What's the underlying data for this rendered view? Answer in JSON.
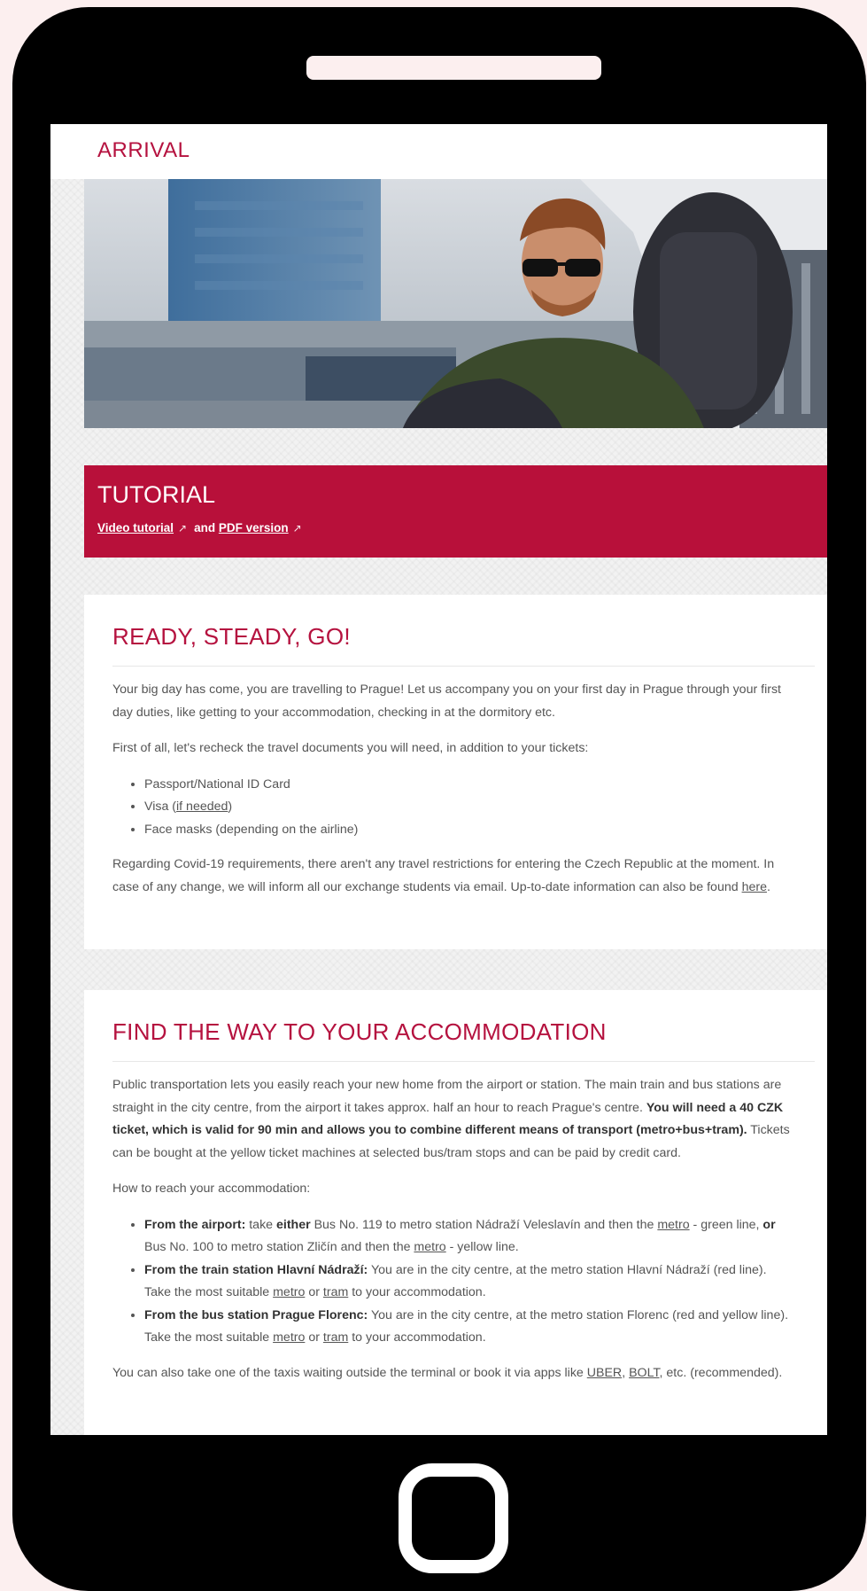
{
  "arrival": {
    "title": "ARRIVAL"
  },
  "tutorial": {
    "title": "TUTORIAL",
    "video_link": "Video tutorial",
    "and": "and",
    "pdf_link": "PDF version"
  },
  "ready": {
    "heading": "READY, STEADY, GO!",
    "p1": "Your big day has come, you are travelling to Prague! Let us accompany you on your first day in Prague through your first day duties, like getting to your accommodation, checking in at the dormitory etc.",
    "p2": "First of all, let's recheck the travel documents you will need, in addition to your tickets:",
    "doc1": "Passport/National ID Card",
    "doc2_pre": "Visa (",
    "doc2_link": "if needed",
    "doc2_post": ")",
    "doc3": "Face masks (depending on the airline)",
    "p3": "Regarding Covid-19 requirements, there aren't any travel restrictions for entering the Czech Republic at the moment. In case of any change, we will inform all our exchange students via email. Up-to-date information can also be found ",
    "p3_link": "here",
    "p3_end": "."
  },
  "accommodation": {
    "heading": "FIND THE WAY TO YOUR ACCOMMODATION",
    "p1_a": "Public transportation lets you easily reach your new home from the airport or station. The main train and bus stations are straight in the city centre, from the airport it takes approx. half an hour to reach Prague's centre. ",
    "p1_b": "You will need a 40 CZK ticket, which is valid for 90 min and allows you to combine different means of transport (metro+bus+tram).",
    "p1_c": " Tickets can be bought at the yellow ticket machines at selected bus/tram stops and can be paid by credit card.",
    "p2": "How to reach your accommodation:",
    "b1_label": "From the airport:",
    "b1_a": " take ",
    "b1_either": "either",
    "b1_b": " Bus No. 119 to metro station Nádraží Veleslavín and then the ",
    "metro": "metro",
    "b1_c": " - green line, ",
    "b1_or": "or",
    "b1_d": " Bus No. 100 to metro station Zličín and then the ",
    "b1_e": " - yellow line.",
    "b2_label": "From the train station Hlavní Nádraží:",
    "b2_a": " You are in the city centre, at the metro station Hlavní Nádraží (red line). Take the most suitable ",
    "or": "or",
    "tram": "tram",
    "to_acc": " to your accommodation.",
    "b3_label": "From the bus station Prague Florenc:",
    "b3_a": " You are in the city centre, at the metro station Florenc (red and yellow line). Take the most suitable ",
    "p3_a": "You can also take one of the taxis waiting outside the terminal or book it via apps like ",
    "uber": "UBER",
    "comma": ",",
    "bolt": "BOLT",
    "p3_b": ", etc. (recommended)."
  }
}
